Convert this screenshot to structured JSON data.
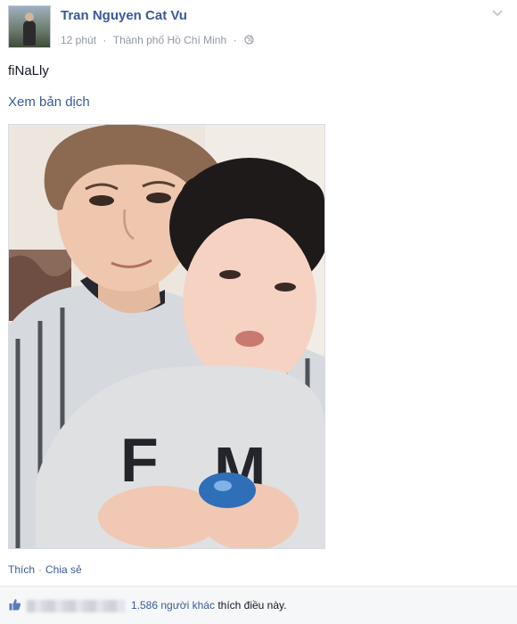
{
  "post": {
    "author": "Tran Nguyen Cat Vu",
    "time": "12 phút",
    "separator": "·",
    "location": "Thành phố Hồ Chí Minh",
    "privacy_icon": "globe-icon",
    "message": "fiNaLly",
    "translate_link": "Xem bản dịch",
    "photo_alt": "",
    "actions": {
      "like": "Thích",
      "share": "Chia sẻ"
    },
    "likes": {
      "count_text": "1.586 người khác",
      "suffix": "thích điều này."
    }
  },
  "colors": {
    "link": "#3b5998",
    "meta": "#9197a3",
    "text": "#141823",
    "likes_bar_bg": "#f6f7f9"
  },
  "icons": [
    "chevron-down-icon",
    "globe-icon",
    "like-icon"
  ]
}
